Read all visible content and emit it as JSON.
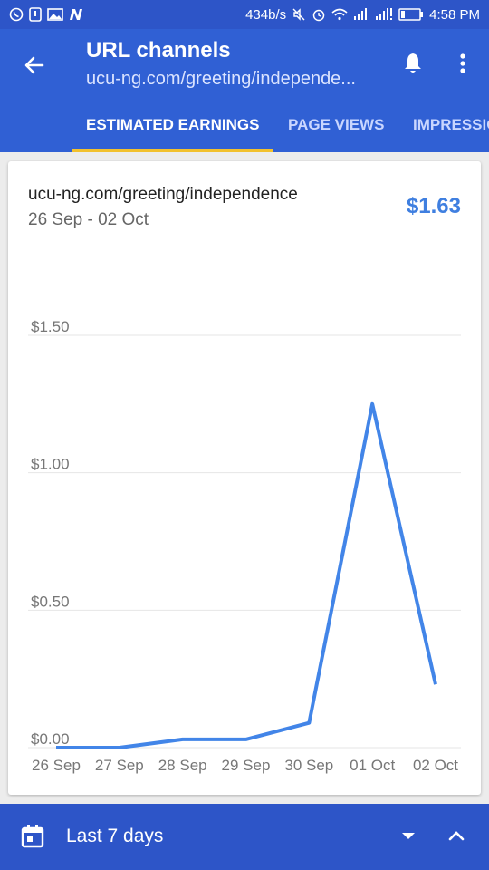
{
  "status_bar": {
    "speed": "434b/s",
    "time": "4:58 PM"
  },
  "app_bar": {
    "title": "URL channels",
    "subtitle": "ucu-ng.com/greeting/independe..."
  },
  "tabs": [
    {
      "label": "ESTIMATED EARNINGS",
      "active": true
    },
    {
      "label": "PAGE VIEWS",
      "active": false
    },
    {
      "label": "IMPRESSIONS",
      "active": false
    }
  ],
  "card": {
    "url": "ucu-ng.com/greeting/independence",
    "date_range": "26 Sep - 02 Oct",
    "total": "$1.63"
  },
  "chart_data": {
    "type": "line",
    "categories": [
      "26 Sep",
      "27 Sep",
      "28 Sep",
      "29 Sep",
      "30 Sep",
      "01 Oct",
      "02 Oct"
    ],
    "series": [
      {
        "values": [
          0.0,
          0.0,
          0.03,
          0.03,
          0.09,
          1.25,
          0.23
        ]
      }
    ],
    "y_ticks": [
      "$0.00",
      "$0.50",
      "$1.00",
      "$1.50"
    ],
    "y_tick_values": [
      0,
      0.5,
      1.0,
      1.5
    ],
    "ylim": [
      0,
      1.5
    ],
    "grid": true,
    "color": "#4285e8"
  },
  "bottom_bar": {
    "range_label": "Last 7 days"
  },
  "colors": {
    "app_bar": "#3060d4",
    "status_bar": "#2d55c8",
    "tab_indicator": "#f2c12e",
    "accent": "#3f7fe0"
  }
}
